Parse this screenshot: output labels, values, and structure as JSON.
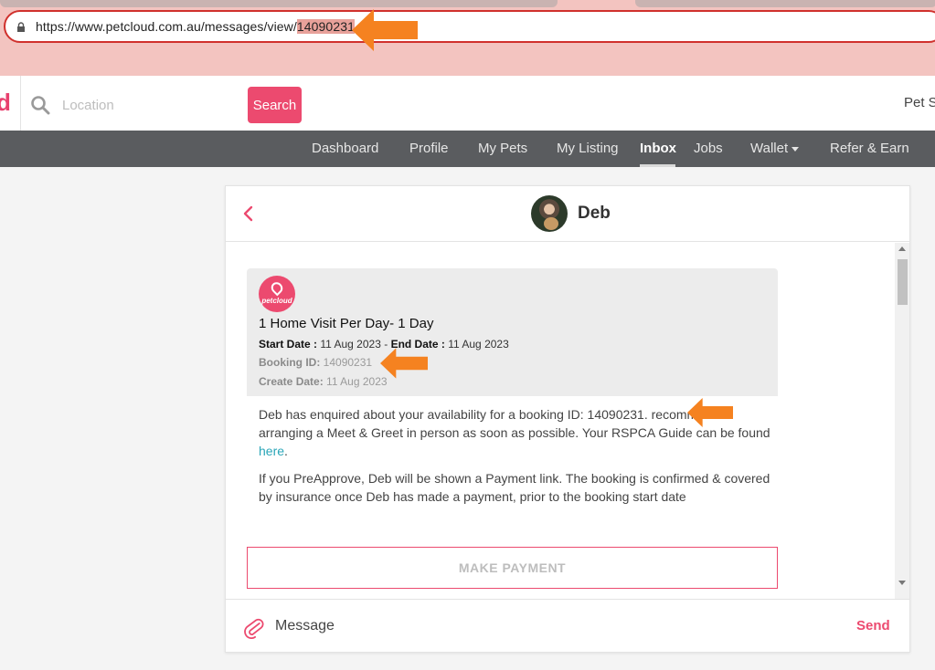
{
  "browser": {
    "url_prefix": "https://www.petcloud.com.au/messages/view/",
    "url_highlight": "14090231"
  },
  "header": {
    "logo_fragment": "d",
    "location_placeholder": "Location",
    "search_label": "Search",
    "right_text": "Pet S"
  },
  "nav": {
    "items": [
      "Dashboard",
      "Profile",
      "My Pets",
      "My Listing",
      "Inbox",
      "Jobs",
      "Wallet",
      "Refer & Earn"
    ],
    "active": "Inbox"
  },
  "chat": {
    "contact_name": "Deb",
    "booking": {
      "logo_text": "petcloud",
      "title": "1 Home Visit Per Day-  1 Day",
      "start_label": "Start Date :",
      "start_value": "11 Aug 2023",
      "dash": "-",
      "end_label": "End Date :",
      "end_value": "11 Aug 2023",
      "booking_id_label": "Booking ID:",
      "booking_id_value": "14090231",
      "create_label": "Create Date:",
      "create_value": "11 Aug 2023"
    },
    "body_p1_before": "Deb has enquired about your availability for a booking ID: 14090231. ",
    "body_p1_middle": "recommend arranging a Meet & Greet in person as soon as possible. Your RSPCA Guide can be found ",
    "body_p1_link": "here",
    "body_p1_after": ".",
    "body_p2": "If you PreApprove, Deb will be shown a Payment link. The booking is confirmed & covered by insurance once Deb has made a payment, prior to the booking start date",
    "make_payment_label": "MAKE PAYMENT",
    "message_placeholder": "Message",
    "send_label": "Send"
  },
  "colors": {
    "brand": "#ec4a6f",
    "annotation": "#f58220",
    "nav_bg": "#5a5c5f"
  }
}
